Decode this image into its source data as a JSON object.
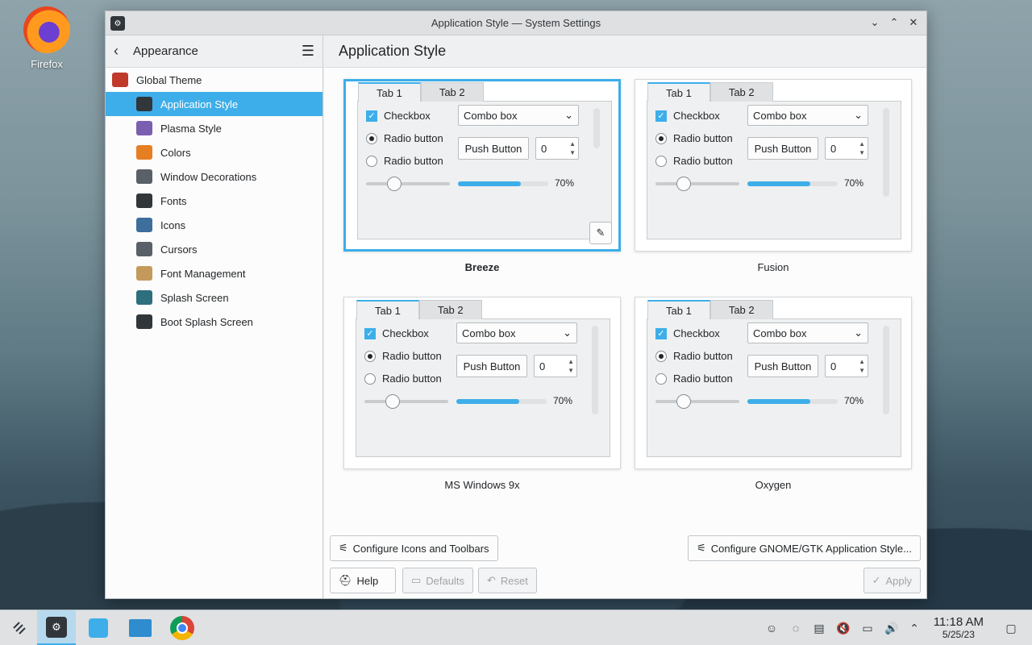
{
  "desktop": {
    "icon_label": "Firefox"
  },
  "window": {
    "title": "Application Style — System Settings"
  },
  "sidebar": {
    "header": "Appearance",
    "items": [
      {
        "label": "Global Theme",
        "level": "top",
        "icon": "global-theme-icon",
        "color": "#c0392b"
      },
      {
        "label": "Application Style",
        "level": "sub",
        "icon": "application-style-icon",
        "color": "#31363b",
        "active": true
      },
      {
        "label": "Plasma Style",
        "level": "sub",
        "icon": "plasma-style-icon",
        "color": "#7a5fb0"
      },
      {
        "label": "Colors",
        "level": "sub",
        "icon": "colors-icon",
        "color": "#e67e22"
      },
      {
        "label": "Window Decorations",
        "level": "sub",
        "icon": "window-decorations-icon",
        "color": "#5a6067"
      },
      {
        "label": "Fonts",
        "level": "sub",
        "icon": "fonts-icon",
        "color": "#31363b"
      },
      {
        "label": "Icons",
        "level": "sub",
        "icon": "icons-icon",
        "color": "#3d6e9c"
      },
      {
        "label": "Cursors",
        "level": "sub",
        "icon": "cursors-icon",
        "color": "#5a6067"
      },
      {
        "label": "Font Management",
        "level": "sub",
        "icon": "font-management-icon",
        "color": "#c49a5a"
      },
      {
        "label": "Splash Screen",
        "level": "sub",
        "icon": "splash-screen-icon",
        "color": "#2e6f7e"
      },
      {
        "label": "Boot Splash Screen",
        "level": "sub",
        "icon": "boot-splash-screen-icon",
        "color": "#31363b"
      }
    ]
  },
  "main": {
    "title": "Application Style",
    "styles": [
      {
        "name": "Breeze",
        "selected": true,
        "tab1": "Tab 1",
        "tab2": "Tab 2",
        "checkbox": "Checkbox",
        "radio1": "Radio button",
        "radio2": "Radio button",
        "combo": "Combo box",
        "push": "Push Button",
        "spin": "0",
        "percent": "70%",
        "progress": 0.7
      },
      {
        "name": "Fusion",
        "selected": false,
        "tab1": "Tab 1",
        "tab2": "Tab 2",
        "checkbox": "Checkbox",
        "radio1": "Radio button",
        "radio2": "Radio button",
        "combo": "Combo box",
        "push": "Push Button",
        "spin": "0",
        "percent": "70%",
        "progress": 0.7
      },
      {
        "name": "MS Windows 9x",
        "selected": false,
        "tab1": "Tab 1",
        "tab2": "Tab 2",
        "checkbox": "Checkbox",
        "radio1": "Radio button",
        "radio2": "Radio button",
        "combo": "Combo box",
        "push": "Push Button",
        "spin": "0",
        "percent": "70%",
        "progress": 0.7
      },
      {
        "name": "Oxygen",
        "selected": false,
        "tab1": "Tab 1",
        "tab2": "Tab 2",
        "checkbox": "Checkbox",
        "radio1": "Radio button",
        "radio2": "Radio button",
        "combo": "Combo box",
        "push": "Push Button",
        "spin": "0",
        "percent": "70%",
        "progress": 0.7
      }
    ],
    "buttons": {
      "configure_icons": "Configure Icons and Toolbars",
      "configure_gtk": "Configure GNOME/GTK Application Style...",
      "help": "Help",
      "defaults": "Defaults",
      "reset": "Reset",
      "apply": "Apply"
    }
  },
  "taskbar": {
    "time": "11:18 AM",
    "date": "5/25/23"
  },
  "colors": {
    "accent": "#3daee9"
  }
}
